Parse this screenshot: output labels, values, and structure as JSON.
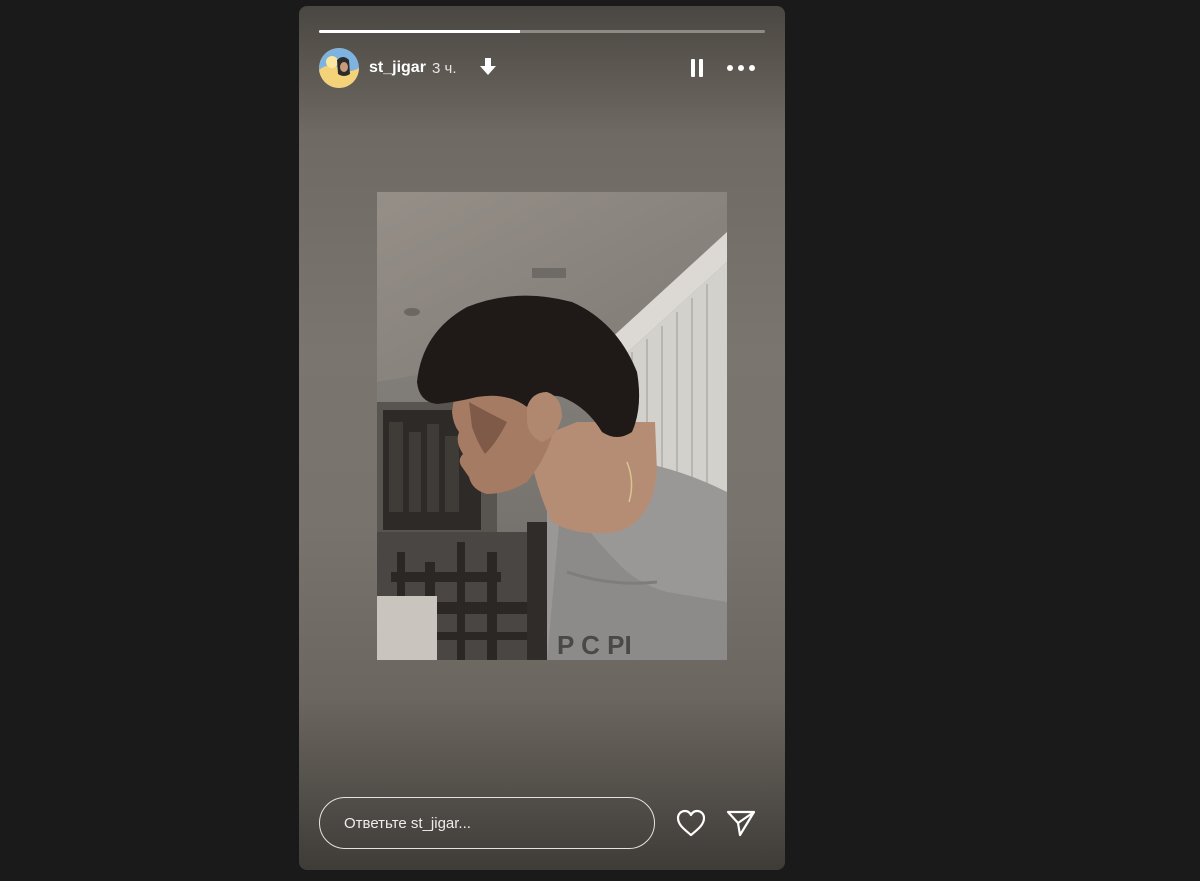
{
  "story": {
    "progress": 0.45,
    "user": {
      "username": "st_jigar",
      "time_ago": "3 ч."
    },
    "icons": {
      "avatar": "avatar-image",
      "download": "download-arrow-icon",
      "pause": "pause-icon",
      "more": "more-horizontal-icon",
      "like": "heart-icon",
      "share": "paper-plane-icon"
    },
    "reply": {
      "placeholder": "Ответьте st_jigar..."
    }
  },
  "colors": {
    "background": "#1a1a1a",
    "text": "#ffffff",
    "progress_track": "rgba(255,255,255,0.35)",
    "progress_fill": "#ffffff"
  }
}
